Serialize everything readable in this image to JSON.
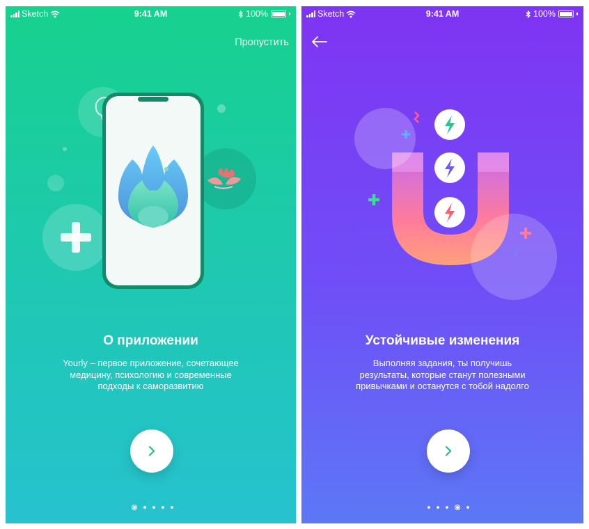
{
  "status_bar": {
    "carrier": "Sketch",
    "time": "9:41 AM",
    "battery": "100%"
  },
  "screens": [
    {
      "skip_label": "Пропустить",
      "title": "О приложении",
      "description": "Yourly – первое приложение, сочетающее\nмедицину, психологию и современные\nподходы к саморазвитию",
      "next_icon": "chevron-right-icon",
      "active_page": 1,
      "page_count": 5
    },
    {
      "back_icon": "arrow-left-icon",
      "title": "Устойчивые изменения",
      "description": "Выполняя задания, ты получишь\nрезультаты, которые станут полезными\nпривычками и останутся с тобой надолго",
      "next_icon": "chevron-right-icon",
      "active_page": 4,
      "page_count": 5
    }
  ],
  "colors": {
    "screen1_top": "#17d18e",
    "screen1_bottom": "#26c2cf",
    "screen2_top": "#7f34f2",
    "screen2_bottom": "#5c78f6",
    "button_arrow": "#22c27a"
  }
}
